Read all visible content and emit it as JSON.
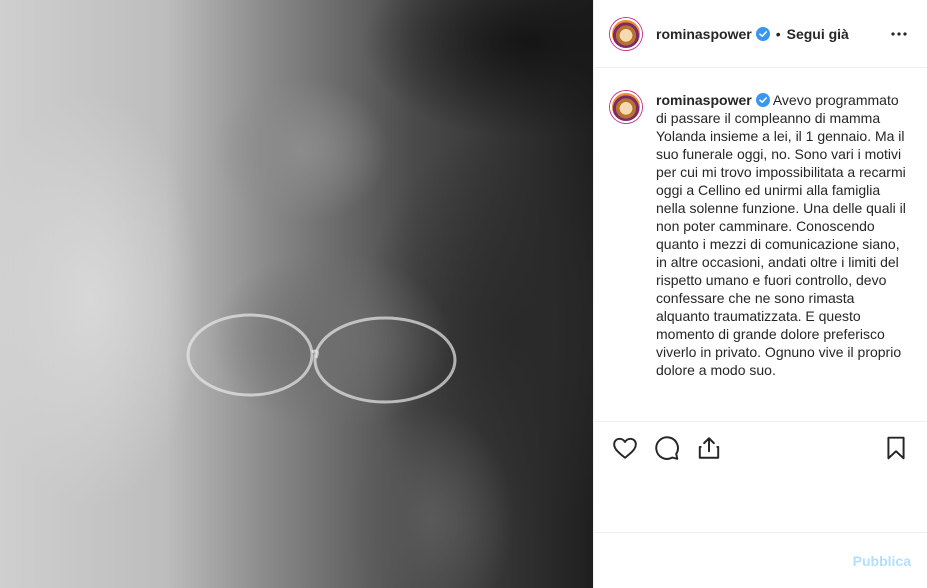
{
  "post": {
    "author": "rominaspower",
    "follow_status": "Segui già",
    "separator": "•",
    "caption": "Avevo programmato di passare il compleanno di mamma Yolanda insieme a lei, il 1 gennaio. Ma il suo funerale oggi, no. Sono vari i motivi per cui mi trovo impossibilitata a recarmi oggi a Cellino ed unirmi alla famiglia nella solenne funzione. Una delle quali il non poter camminare. Conoscendo quanto i mezzi di comunicazione siano, in altre occasioni, andati oltre i limiti del rispetto umano e fuori controllo, devo confessare che ne sono rimasta alquanto traumatizzata. E questo momento di grande dolore preferisco viverlo in privato. Ognuno vive il proprio dolore a modo suo."
  },
  "actions": {
    "like_icon": "heart-icon",
    "comment_icon": "comment-icon",
    "share_icon": "share-icon",
    "save_icon": "bookmark-icon"
  },
  "comment_bar": {
    "placeholder": "",
    "publish_label": "Pubblica"
  },
  "colors": {
    "verified": "#3897f0",
    "publish_disabled": "#b2dffc",
    "divider": "#efefef"
  }
}
